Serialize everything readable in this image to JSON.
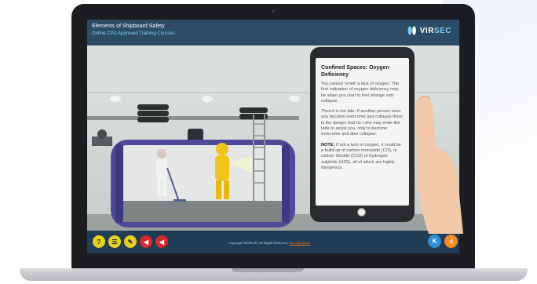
{
  "course": {
    "title": "Elements of Shipboard Safety",
    "subtitle": "Online CPD Approved Training Courses"
  },
  "logo": {
    "text_main": "VIR",
    "text_accent": "SEC"
  },
  "phone": {
    "title": "Confined Spaces: Oxygen Deficiency",
    "paragraphs": [
      "You cannot 'smell' a lack of oxygen. The first indication of oxygen deficiency may be when you start to feel strange and collapse.",
      "Then it is too late. If another person sees you become overcome and collapse there is the danger that he / she may enter the tank to assist you, only to become overcome and also collapse."
    ],
    "note_label": "NOTE:",
    "note_text": " If not a lack of oxygen, it could be a build-up of carbon monoxide (CO), or carbon dioxide (CO2) or hydrogen sulphide (H2S), all of which are highly dangerous."
  },
  "footer": {
    "copyright": "Copyright VIRSEC® | All Rights Reserved |",
    "security_link": "Security Notice",
    "tools": [
      {
        "name": "help-icon",
        "glyph": "?",
        "color": "#e6d21a",
        "text_color": "#2b2b2b"
      },
      {
        "name": "menu-list-icon",
        "glyph": "☰",
        "color": "#e6d21a",
        "text_color": "#2b2b2b"
      },
      {
        "name": "pencil-icon",
        "glyph": "✎",
        "color": "#e6d21a",
        "text_color": "#2b2b2b"
      },
      {
        "name": "audio-icon",
        "glyph": "◀",
        "color": "#d42a2a",
        "text_color": "#ffffff"
      },
      {
        "name": "audio-mute-icon",
        "glyph": "◀",
        "color": "#d42a2a",
        "text_color": "#ffffff"
      }
    ],
    "nav": [
      {
        "name": "previous-button",
        "glyph": "K",
        "color": "#2f8fd6"
      },
      {
        "name": "next-button",
        "glyph": "›|",
        "color": "#f28a1c"
      }
    ]
  },
  "colors": {
    "header": "#2b4b67",
    "footer": "#213d55",
    "accent": "#7fd0f5",
    "tank": "#4f4a9a"
  }
}
